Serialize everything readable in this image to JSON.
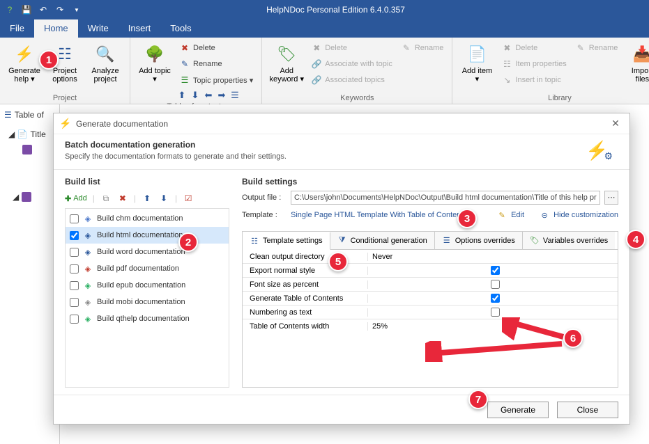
{
  "app": {
    "title": "HelpNDoc Personal Edition 6.4.0.357"
  },
  "menu": {
    "file": "File",
    "home": "Home",
    "write": "Write",
    "insert": "Insert",
    "tools": "Tools"
  },
  "ribbon": {
    "project": {
      "label": "Project",
      "generate": "Generate help ▾",
      "options": "Project options",
      "analyze": "Analyze project"
    },
    "toc": {
      "label": "Table of contents",
      "addtopic": "Add topic ▾",
      "delete": "Delete",
      "rename": "Rename",
      "props": "Topic properties ▾"
    },
    "keywords": {
      "label": "Keywords",
      "add": "Add keyword ▾",
      "delete": "Delete",
      "rename": "Rename",
      "assoc": "Associate with topic",
      "assoc_topics": "Associated topics"
    },
    "library": {
      "label": "Library",
      "add": "Add item ▾",
      "delete": "Delete",
      "rename": "Rename",
      "props": "Item properties",
      "insert": "Insert in topic",
      "import": "Import files"
    }
  },
  "tree": {
    "header": "Table of",
    "title": "Title"
  },
  "dialog": {
    "title": "Generate documentation",
    "batch_title": "Batch documentation generation",
    "batch_desc": "Specify the documentation formats to generate and their settings.",
    "buildlist_title": "Build list",
    "add": "Add",
    "items": [
      {
        "label": "Build chm documentation",
        "checked": false,
        "color": "#4a76c9"
      },
      {
        "label": "Build html documentation",
        "checked": true,
        "color": "#2b579a",
        "selected": true
      },
      {
        "label": "Build word documentation",
        "checked": false,
        "color": "#2b579a"
      },
      {
        "label": "Build pdf documentation",
        "checked": false,
        "color": "#c0392b"
      },
      {
        "label": "Build epub documentation",
        "checked": false,
        "color": "#27ae60"
      },
      {
        "label": "Build mobi documentation",
        "checked": false,
        "color": "#888"
      },
      {
        "label": "Build qthelp documentation",
        "checked": false,
        "color": "#27ae60"
      }
    ],
    "settings_title": "Build settings",
    "output_label": "Output file :",
    "output_path": "C:\\Users\\john\\Documents\\HelpNDoc\\Output\\Build html documentation\\Title of this help project.h",
    "template_label": "Template :",
    "template_name": "Single Page HTML Template With Table of Contents",
    "edit": "Edit",
    "hide": "Hide customization",
    "tabs": {
      "template": "Template settings",
      "conditional": "Conditional generation",
      "options": "Options overrides",
      "variables": "Variables overrides"
    },
    "grid": {
      "clean": "Clean output directory",
      "clean_val": "Never",
      "export_normal": "Export normal style",
      "font_percent": "Font size as percent",
      "gen_toc": "Generate Table of Contents",
      "numbering": "Numbering as text",
      "toc_width": "Table of Contents width",
      "toc_width_val": "25%"
    },
    "generate": "Generate",
    "close": "Close"
  },
  "markers": {
    "m1": "1",
    "m2": "2",
    "m3": "3",
    "m4": "4",
    "m5": "5",
    "m6": "6",
    "m7": "7"
  }
}
